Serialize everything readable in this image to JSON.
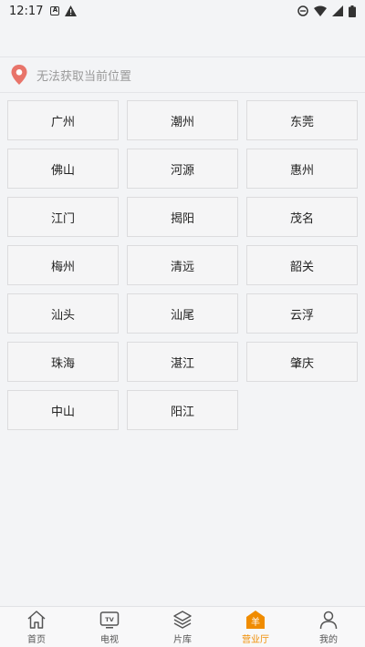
{
  "status_bar": {
    "time": "12:17",
    "box_icon_letter": "A"
  },
  "location": {
    "text": "无法获取当前位置"
  },
  "cities": [
    "广州",
    "潮州",
    "东莞",
    "佛山",
    "河源",
    "惠州",
    "江门",
    "揭阳",
    "茂名",
    "梅州",
    "清远",
    "韶关",
    "汕头",
    "汕尾",
    "云浮",
    "珠海",
    "湛江",
    "肇庆",
    "中山",
    "阳江"
  ],
  "tabs": [
    {
      "label": "首页"
    },
    {
      "label": "电视",
      "icon_text": "TV"
    },
    {
      "label": "片库"
    },
    {
      "label": "营业厅",
      "icon_text": "羊"
    },
    {
      "label": "我的"
    }
  ],
  "colors": {
    "accent": "#f08c00",
    "pin": "#e8746a"
  }
}
